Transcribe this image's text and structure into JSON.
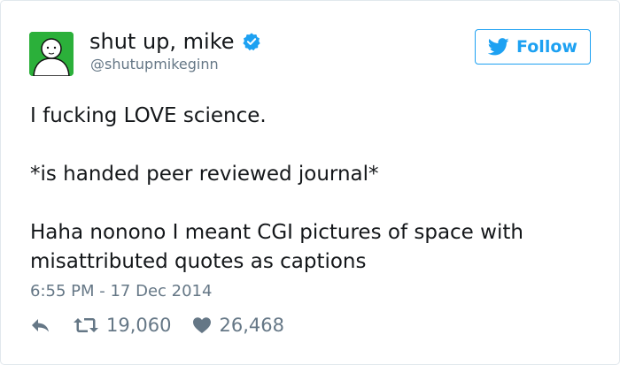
{
  "user": {
    "display_name": "shut up, mike",
    "handle": "@shutupmikeginn",
    "verified": true
  },
  "follow": {
    "label": "Follow"
  },
  "tweet": {
    "lines": [
      "I fucking LOVE science.",
      "*is handed peer reviewed journal*",
      "Haha nonono I meant CGI pictures of space with misattributed quotes as captions"
    ]
  },
  "timestamp": "6:55 PM - 17 Dec 2014",
  "stats": {
    "retweets": "19,060",
    "likes": "26,468"
  },
  "colors": {
    "accent": "#1da1f2",
    "avatar_bg": "#2bb03a",
    "muted": "#657786"
  },
  "icons": {
    "verified": "verified-badge-icon",
    "bird": "twitter-bird-icon",
    "reply": "reply-icon",
    "retweet": "retweet-icon",
    "like": "heart-icon"
  }
}
